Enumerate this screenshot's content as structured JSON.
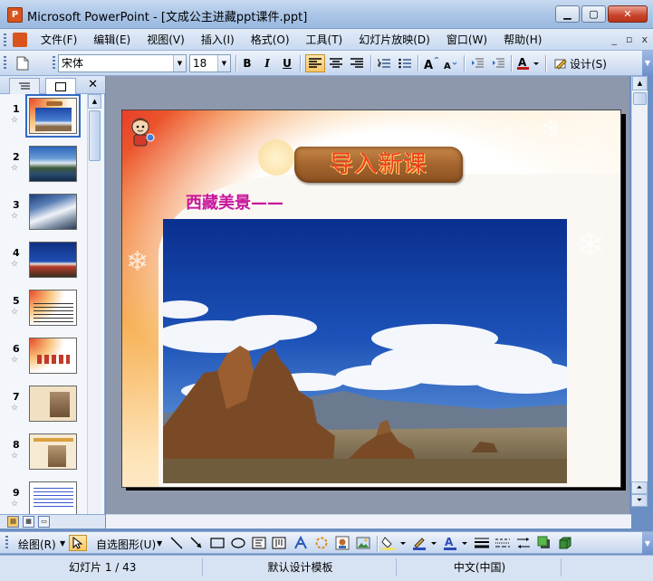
{
  "window": {
    "title": "Microsoft PowerPoint - [文成公主进藏ppt课件.ppt]",
    "app_icon_letter": "P"
  },
  "menu": {
    "items": [
      "文件(F)",
      "编辑(E)",
      "视图(V)",
      "插入(I)",
      "格式(O)",
      "工具(T)",
      "幻灯片放映(D)",
      "窗口(W)",
      "帮助(H)"
    ],
    "right_controls": [
      "_",
      "▫",
      "x"
    ]
  },
  "toolbar": {
    "font_name": "宋体",
    "font_size": "18",
    "bold": "B",
    "italic": "I",
    "underline": "U",
    "design_label": "设计(S)",
    "font_color": "#c0160f"
  },
  "left_pane": {
    "tabs": [
      "outline-tab",
      "slides-tab"
    ],
    "thumbnails": [
      {
        "num": "1",
        "theme": "sky",
        "selected": true
      },
      {
        "num": "2",
        "theme": "lake"
      },
      {
        "num": "3",
        "theme": "snow"
      },
      {
        "num": "4",
        "theme": "palace"
      },
      {
        "num": "5",
        "theme": "text-orange"
      },
      {
        "num": "6",
        "theme": "text-orange"
      },
      {
        "num": "7",
        "theme": "paper"
      },
      {
        "num": "8",
        "theme": "paper"
      },
      {
        "num": "9",
        "theme": "text-blue"
      }
    ]
  },
  "slide": {
    "title": "导入新课",
    "subtitle": "西藏美景——",
    "title_color": "#f33a1d",
    "subtitle_color": "#c8169b"
  },
  "drawbar": {
    "draw_label": "绘图(R)",
    "autoshape_label": "自选图形(U)"
  },
  "status": {
    "slide_pos": "幻灯片 1 / 43",
    "template": "默认设计模板",
    "language": "中文(中国)"
  }
}
